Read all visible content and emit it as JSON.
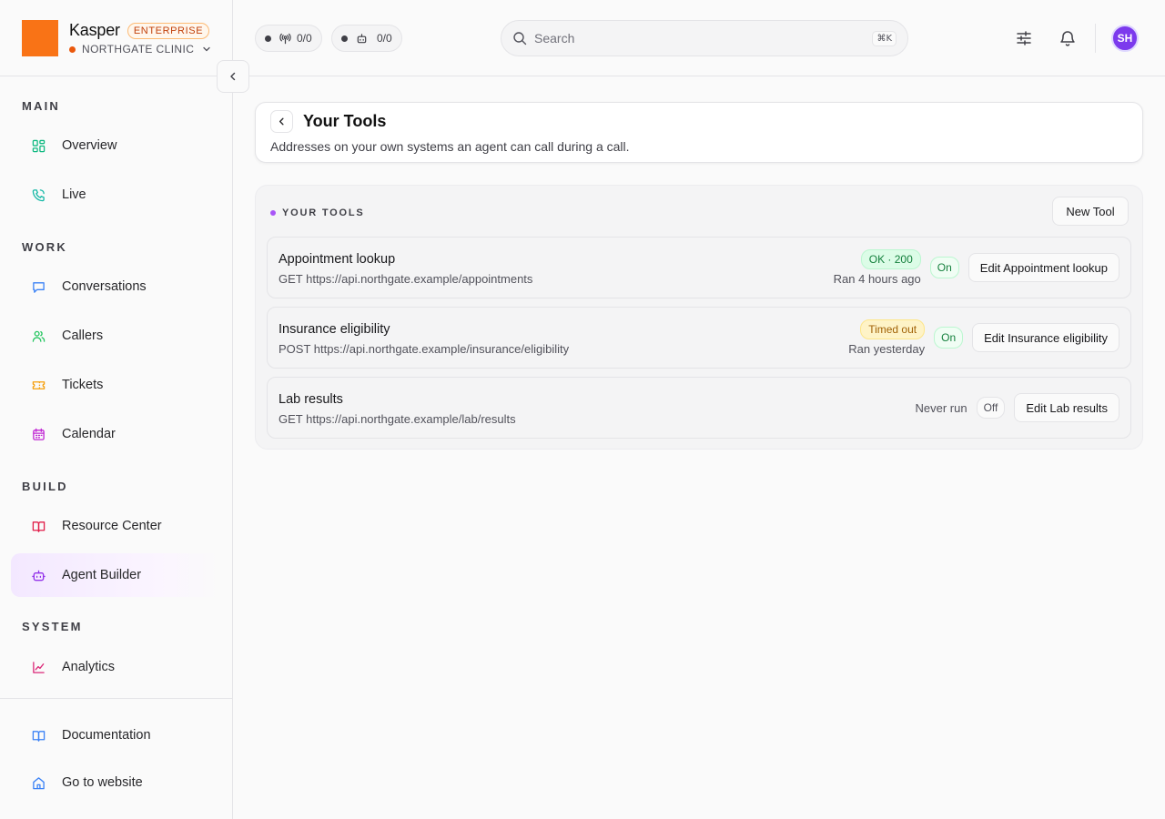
{
  "brand": {
    "name": "Kasper",
    "plan_badge": "ENTERPRISE",
    "org": "NORTHGATE CLINIC",
    "logo_color": "#f97316"
  },
  "sidebar": {
    "sections": [
      {
        "title": "MAIN",
        "items": [
          {
            "label": "Overview",
            "icon": "grid-icon"
          },
          {
            "label": "Live",
            "icon": "phone-icon"
          }
        ]
      },
      {
        "title": "WORK",
        "items": [
          {
            "label": "Conversations",
            "icon": "chat-icon"
          },
          {
            "label": "Callers",
            "icon": "users-icon"
          },
          {
            "label": "Tickets",
            "icon": "ticket-icon"
          },
          {
            "label": "Calendar",
            "icon": "calendar-icon"
          }
        ]
      },
      {
        "title": "BUILD",
        "items": [
          {
            "label": "Resource Center",
            "icon": "book-icon"
          },
          {
            "label": "Agent Builder",
            "icon": "bot-icon",
            "active": true
          }
        ]
      },
      {
        "title": "SYSTEM",
        "items": [
          {
            "label": "Analytics",
            "icon": "chart-icon"
          }
        ]
      }
    ],
    "bottom": [
      {
        "label": "Documentation",
        "icon": "book-open-icon"
      },
      {
        "label": "Go to website",
        "icon": "home-icon"
      }
    ]
  },
  "topbar": {
    "live_calls": "0/0",
    "agents": "0/0",
    "search_placeholder": "Search",
    "search_shortcut": "⌘K",
    "avatar_initials": "SH",
    "avatar_color": "#7c3aed"
  },
  "page": {
    "title": "Your Tools",
    "subtitle": "Addresses on your own systems an agent can call during a call."
  },
  "tools": {
    "section_label": "YOUR TOOLS",
    "new_button": "New Tool",
    "items": [
      {
        "name": "Appointment lookup",
        "endpoint": "GET https://api.northgate.example/appointments",
        "status": "OK · 200",
        "status_kind": "ok",
        "last_run": "Ran 4 hours ago",
        "toggle": "On",
        "edit_label": "Edit Appointment lookup"
      },
      {
        "name": "Insurance eligibility",
        "endpoint": "POST https://api.northgate.example/insurance/eligibility",
        "status": "Timed out",
        "status_kind": "warn",
        "last_run": "Ran yesterday",
        "toggle": "On",
        "edit_label": "Edit Insurance eligibility"
      },
      {
        "name": "Lab results",
        "endpoint": "GET https://api.northgate.example/lab/results",
        "status": "",
        "status_kind": "none",
        "last_run": "Never run",
        "toggle": "Off",
        "edit_label": "Edit Lab results"
      }
    ]
  },
  "colors": {
    "accent": "#a855f7",
    "ok": "#15803d",
    "warn": "#a16207",
    "brand": "#f97316"
  }
}
